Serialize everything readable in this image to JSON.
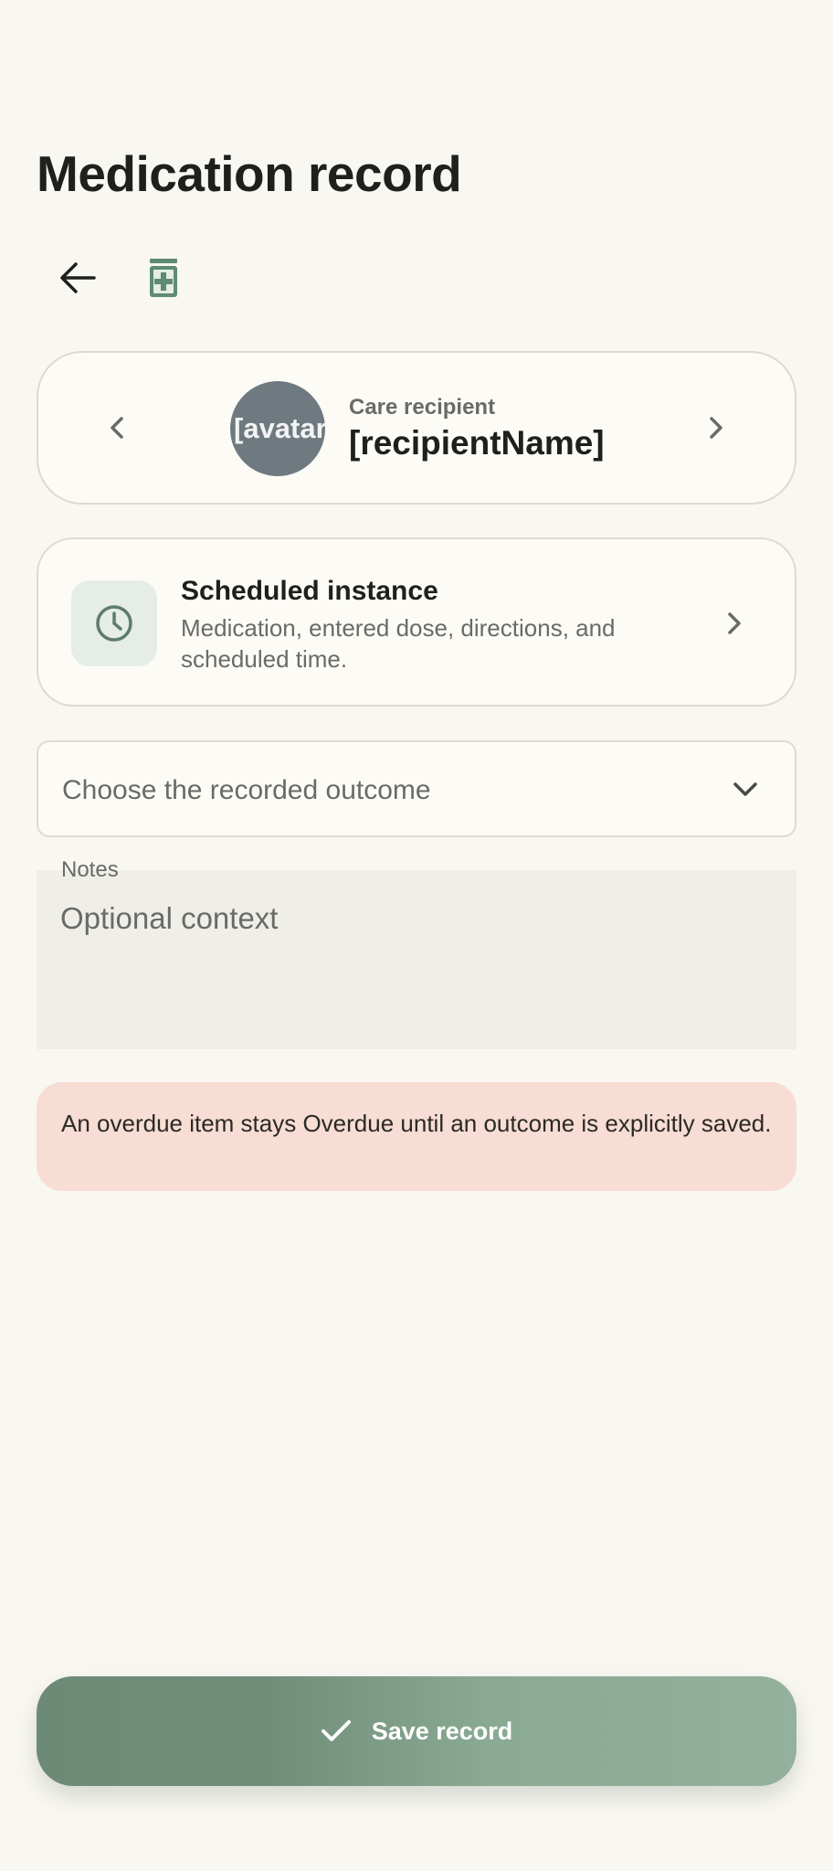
{
  "page": {
    "title": "Medication record"
  },
  "toolbar": {
    "back_icon": "arrow-left-icon",
    "medication_icon": "medicine-bottle-icon"
  },
  "recipient": {
    "label": "Care recipient",
    "name": "[recipientName]",
    "avatar_text": "[avatar]",
    "avatar_color": "#6f7a80"
  },
  "schedule": {
    "title": "Scheduled instance",
    "description": "Medication, entered dose, directions, and scheduled time."
  },
  "outcome": {
    "placeholder": "Choose the recorded outcome"
  },
  "notes": {
    "label": "Notes",
    "placeholder": "Optional context"
  },
  "warning": {
    "text": "An overdue item stays Overdue until an outcome is explicitly saved."
  },
  "save": {
    "label": "Save record"
  },
  "colors": {
    "background": "#f9f7f2",
    "accent": "#6f8e79",
    "warning_bg": "#f7ddd3",
    "clock_tile": "#e5ede6"
  }
}
